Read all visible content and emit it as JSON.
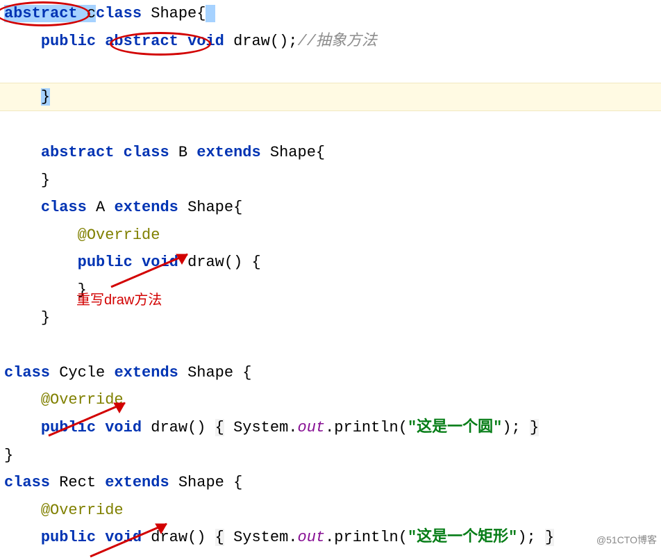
{
  "code": {
    "l1": {
      "kw1": "abstract",
      "kw2": "class",
      "name": "Shape"
    },
    "l2": {
      "kw1": "public",
      "kw2": "abstract",
      "kw3": "void",
      "name": "draw",
      "cmt": "//抽象方法"
    },
    "l3": {
      "brace": "}"
    },
    "l4": {
      "kw1": "abstract",
      "kw2": "class",
      "name": "B",
      "kw3": "extends",
      "sup": "Shape"
    },
    "l5": {
      "brace": "}"
    },
    "l6": {
      "kw1": "class",
      "name": "A",
      "kw2": "extends",
      "sup": "Shape"
    },
    "l7": {
      "ann": "@Override"
    },
    "l8": {
      "kw1": "public",
      "kw2": "void",
      "name": "draw"
    },
    "l9": {
      "brace": "}"
    },
    "l10": {
      "brace": "}"
    },
    "l11": {
      "kw1": "class",
      "name": "Cycle",
      "kw2": "extends",
      "sup": "Shape"
    },
    "l12": {
      "ann": "@Override"
    },
    "l13": {
      "kw1": "public",
      "kw2": "void",
      "name": "draw",
      "stmt1": "System.",
      "fld": "out",
      "stmt2": ".println(",
      "str": "\"这是一个圆\"",
      "stmt3": ");"
    },
    "l14": {
      "brace": "}"
    },
    "l15": {
      "kw1": "class",
      "name": "Rect",
      "kw2": "extends",
      "sup": "Shape"
    },
    "l16": {
      "ann": "@Override"
    },
    "l17": {
      "kw1": "public",
      "kw2": "void",
      "name": "draw",
      "stmt1": "System.",
      "fld": "out",
      "stmt2": ".println(",
      "str": "\"这是一个矩形\"",
      "stmt3": ");"
    }
  },
  "annotations": {
    "note1": "重写draw方法"
  },
  "watermark": "@51CTO博客"
}
